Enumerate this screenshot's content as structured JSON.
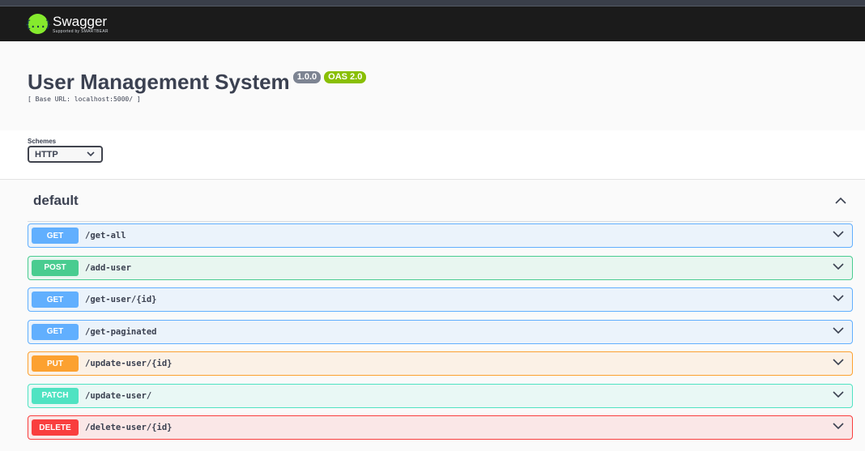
{
  "header": {
    "logo_text": "Swagger",
    "logo_sub": "Supported by SMARTBEAR",
    "logo_glyph": "{...}"
  },
  "info": {
    "title": "User Management System",
    "version": "1.0.0",
    "oas": "OAS 2.0",
    "base_url": "[ Base URL: localhost:5000/ ]"
  },
  "schemes": {
    "label": "Schemes",
    "selected": "HTTP"
  },
  "tag": {
    "name": "default",
    "expanded": true
  },
  "operations": [
    {
      "method": "GET",
      "path": "/get-all",
      "color": "#61affe"
    },
    {
      "method": "POST",
      "path": "/add-user",
      "color": "#49cc90"
    },
    {
      "method": "GET",
      "path": "/get-user/{id}",
      "color": "#61affe"
    },
    {
      "method": "GET",
      "path": "/get-paginated",
      "color": "#61affe"
    },
    {
      "method": "PUT",
      "path": "/update-user/{id}",
      "color": "#fca130"
    },
    {
      "method": "PATCH",
      "path": "/update-user/",
      "color": "#50e3c2"
    },
    {
      "method": "DELETE",
      "path": "/delete-user/{id}",
      "color": "#f93e3e"
    }
  ],
  "icons": {
    "logo": "swagger-logo-icon",
    "select": "chevron-down-icon",
    "collapse": "chevron-up-icon",
    "op_expand": "chevron-down-icon"
  }
}
